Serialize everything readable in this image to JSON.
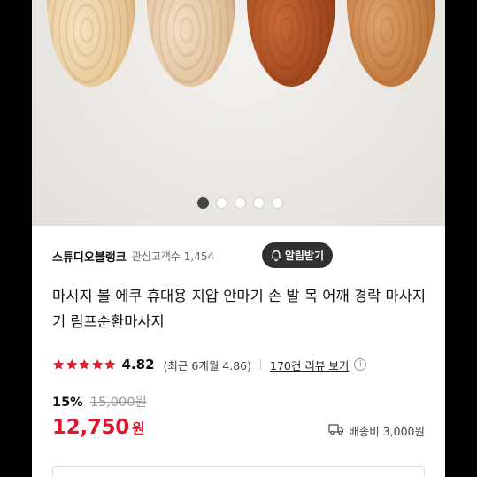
{
  "gallery": {
    "slide_count": 5,
    "active_index": 0
  },
  "seller": {
    "name": "스튜디오블랭크",
    "followers_text": "관심고객수 1,454",
    "alarm_button": "알림받기"
  },
  "product": {
    "title": "마시지 볼 에쿠 휴대용 지압 안마기 손 발 목 어깨 경락 마사지기 림프순환마사지"
  },
  "rating": {
    "stars": 5,
    "value": "4.82",
    "recent_text": "(최근 6개월 4.86)",
    "reviews_link": "170건 리뷰 보기",
    "info_icon": "ⓘ",
    "star_color": "#d8212c"
  },
  "pricing": {
    "discount": "15%",
    "original_price": "15,000원",
    "price": "12,750",
    "currency": "원",
    "price_color": "#e0152c"
  },
  "shipping": {
    "icon": "truck-icon",
    "text": "배송비 3,000원"
  }
}
